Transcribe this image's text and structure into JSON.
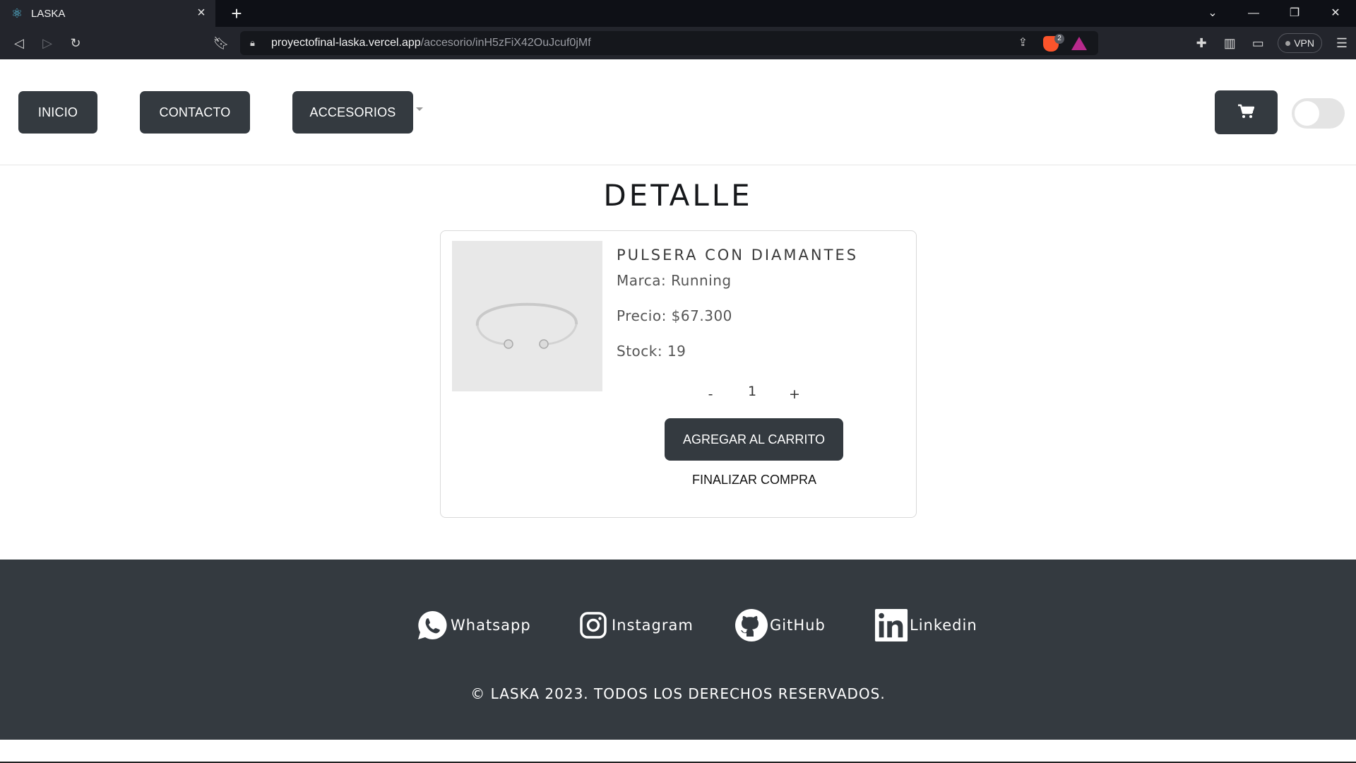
{
  "browser": {
    "tab_title": "LASKA",
    "tab_icon": "react-icon",
    "url_host": "proyectofinal-laska.vercel.app",
    "url_path": "/accesorio/inH5zFiX42OuJcuf0jMf",
    "brave_badge_count": "2",
    "vpn_label": "VPN"
  },
  "navbar": {
    "inicio": "INICIO",
    "contacto": "CONTACTO",
    "accesorios": "ACCESORIOS"
  },
  "page": {
    "title": "DETALLE"
  },
  "product": {
    "name": "PULSERA CON DIAMANTES",
    "brand": "Marca: Running",
    "price": "Precio: $67.300",
    "stock": "Stock: 19",
    "qty_minus": "-",
    "quantity": "1",
    "qty_plus": "+",
    "add_to_cart": "AGREGAR AL CARRITO",
    "finish_purchase": "FINALIZAR COMPRA"
  },
  "footer": {
    "links": [
      {
        "label": "Whatsapp",
        "icon": "whatsapp-icon"
      },
      {
        "label": "Instagram",
        "icon": "instagram-icon"
      },
      {
        "label": "GitHub",
        "icon": "github-icon"
      },
      {
        "label": "Linkedin",
        "icon": "linkedin-icon"
      }
    ],
    "copyright": "© LASKA 2023. TODOS LOS DERECHOS RESERVADOS."
  },
  "colors": {
    "primary_dark": "#343a40",
    "chrome_bg": "#23252c",
    "tab_strip": "#0e1016"
  }
}
